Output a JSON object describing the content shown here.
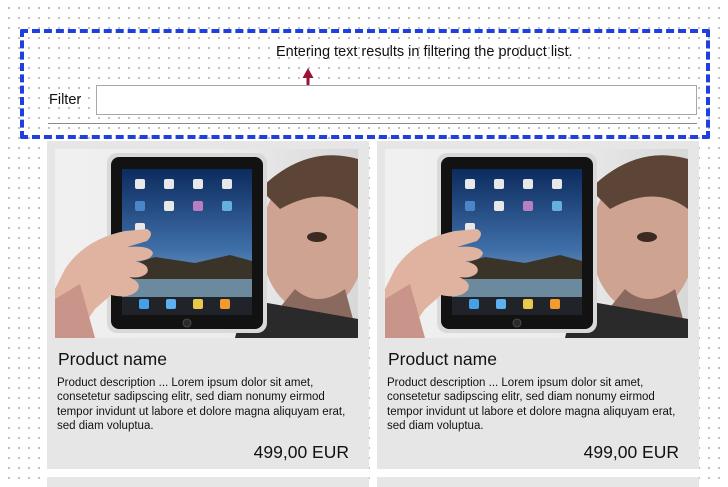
{
  "annotation": {
    "text": "Entering text results in filtering the product list.",
    "arrow_icon": "arrow-up-icon",
    "box_color": "#1f3fe0",
    "arrow_color": "#9b1236"
  },
  "filter": {
    "label": "Filter",
    "value": "",
    "placeholder": ""
  },
  "products": [
    {
      "image_icon": "product-photo-tablet",
      "name": "Product name",
      "description": "Product description   ... Lorem ipsum dolor sit amet, consetetur sadipscing elitr, sed diam nonumy eirmod tempor invidunt ut labore et dolore magna aliquyam erat, sed diam voluptua.",
      "price": "499,00 EUR"
    },
    {
      "image_icon": "product-photo-tablet",
      "name": "Product name",
      "description": "Product description   ... Lorem ipsum dolor sit amet, consetetur sadipscing elitr, sed diam nonumy eirmod tempor invidunt ut labore et dolore magna aliquyam erat, sed diam voluptua.",
      "price": "499,00 EUR"
    }
  ]
}
